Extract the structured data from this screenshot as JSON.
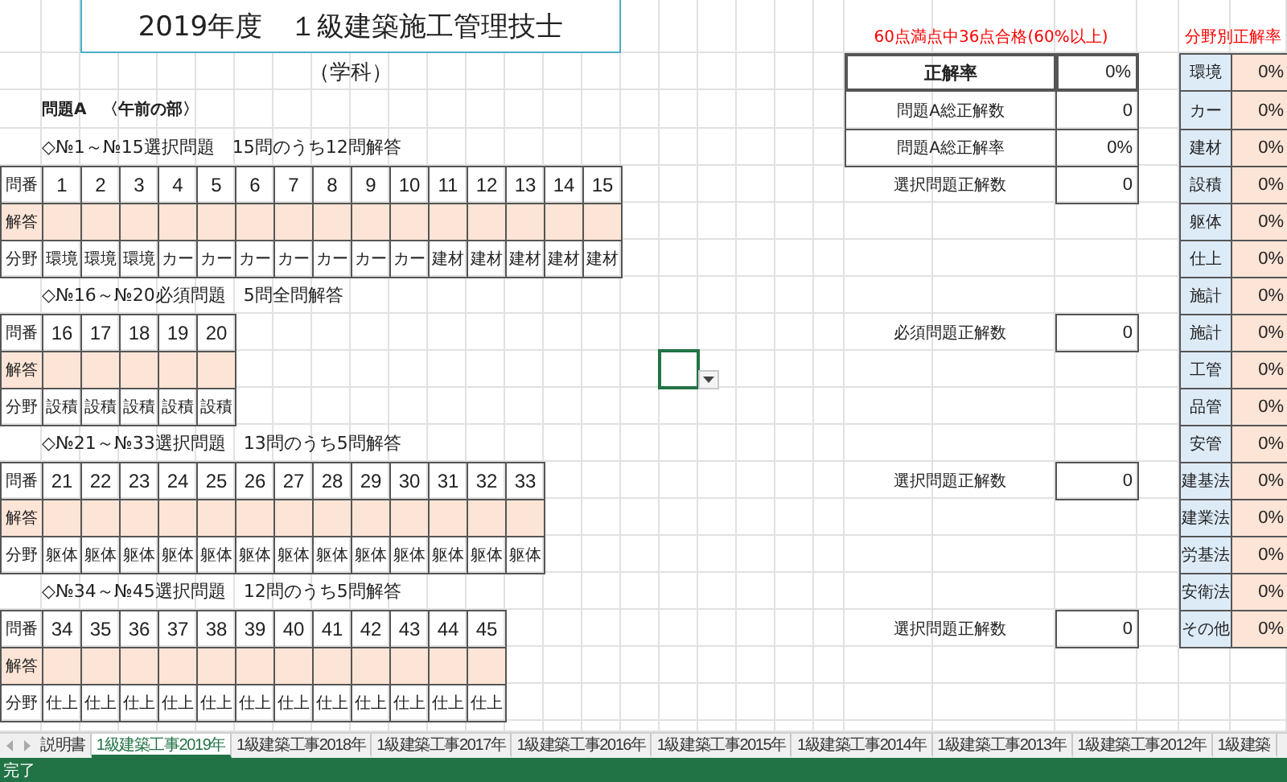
{
  "title": "2019年度　１級建築施工管理技士",
  "subtitle": "（学科）",
  "section_heading": "問題A　〈午前の部〉",
  "groups": [
    {
      "heading": "◇№1～№15選択問題　15問のうち12問解答",
      "number_label": "問番",
      "answer_label": "解答",
      "field_label": "分野",
      "numbers": [
        "1",
        "2",
        "3",
        "4",
        "5",
        "6",
        "7",
        "8",
        "9",
        "10",
        "11",
        "12",
        "13",
        "14",
        "15"
      ],
      "fields": [
        "環境",
        "環境",
        "環境",
        "カー",
        "カー",
        "カー",
        "カー",
        "カー",
        "カー",
        "カー",
        "建材",
        "建材",
        "建材",
        "建材",
        "建材"
      ],
      "score": {
        "label": "選択問題正解数",
        "value": "0"
      }
    },
    {
      "heading": "◇№16～№20必須問題　5問全問解答",
      "number_label": "問番",
      "answer_label": "解答",
      "field_label": "分野",
      "numbers": [
        "16",
        "17",
        "18",
        "19",
        "20"
      ],
      "fields": [
        "設積",
        "設積",
        "設積",
        "設積",
        "設積"
      ],
      "score": {
        "label": "必須問題正解数",
        "value": "0"
      }
    },
    {
      "heading": "◇№21～№33選択問題　13問のうち5問解答",
      "number_label": "問番",
      "answer_label": "解答",
      "field_label": "分野",
      "numbers": [
        "21",
        "22",
        "23",
        "24",
        "25",
        "26",
        "27",
        "28",
        "29",
        "30",
        "31",
        "32",
        "33"
      ],
      "fields": [
        "躯体",
        "躯体",
        "躯体",
        "躯体",
        "躯体",
        "躯体",
        "躯体",
        "躯体",
        "躯体",
        "躯体",
        "躯体",
        "躯体",
        "躯体"
      ],
      "score": {
        "label": "選択問題正解数",
        "value": "0"
      }
    },
    {
      "heading": "◇№34～№45選択問題　12問のうち5問解答",
      "number_label": "問番",
      "answer_label": "解答",
      "field_label": "分野",
      "numbers": [
        "34",
        "35",
        "36",
        "37",
        "38",
        "39",
        "40",
        "41",
        "42",
        "43",
        "44",
        "45"
      ],
      "fields": [
        "仕上",
        "仕上",
        "仕上",
        "仕上",
        "仕上",
        "仕上",
        "仕上",
        "仕上",
        "仕上",
        "仕上",
        "仕上",
        "仕上"
      ],
      "score": {
        "label": "選択問題正解数",
        "value": "0"
      }
    }
  ],
  "pass_note": "60点満点中36点合格(60%以上)",
  "correct_rate": {
    "label": "正解率",
    "value": "0%"
  },
  "totals": [
    {
      "label": "問題A総正解数",
      "value": "0"
    },
    {
      "label": "問題A総正解率",
      "value": "0%"
    }
  ],
  "category_header": "分野別正解率",
  "categories": [
    {
      "name": "環境",
      "value": "0%"
    },
    {
      "name": "カー",
      "value": "0%"
    },
    {
      "name": "建材",
      "value": "0%"
    },
    {
      "name": "設積",
      "value": "0%"
    },
    {
      "name": "躯体",
      "value": "0%"
    },
    {
      "name": "仕上",
      "value": "0%"
    },
    {
      "name": "施計",
      "value": "0%"
    },
    {
      "name": "施計",
      "value": "0%"
    },
    {
      "name": "工管",
      "value": "0%"
    },
    {
      "name": "品管",
      "value": "0%"
    },
    {
      "name": "安管",
      "value": "0%"
    },
    {
      "name": "建基法",
      "value": "0%"
    },
    {
      "name": "建業法",
      "value": "0%"
    },
    {
      "name": "労基法",
      "value": "0%"
    },
    {
      "name": "安衛法",
      "value": "0%"
    },
    {
      "name": "その他",
      "value": "0%"
    }
  ],
  "sheet_tabs": [
    {
      "label": "説明書",
      "selected": false
    },
    {
      "label": "1級建築工事2019年",
      "selected": true
    },
    {
      "label": "1級建築工事2018年",
      "selected": false
    },
    {
      "label": "1級建築工事2017年",
      "selected": false
    },
    {
      "label": "1級建築工事2016年",
      "selected": false
    },
    {
      "label": "1級建築工事2015年",
      "selected": false
    },
    {
      "label": "1級建築工事2014年",
      "selected": false
    },
    {
      "label": "1級建築工事2013年",
      "selected": false
    },
    {
      "label": "1級建築工事2012年",
      "selected": false
    },
    {
      "label": "1級建築",
      "selected": false
    }
  ],
  "status": "完了"
}
